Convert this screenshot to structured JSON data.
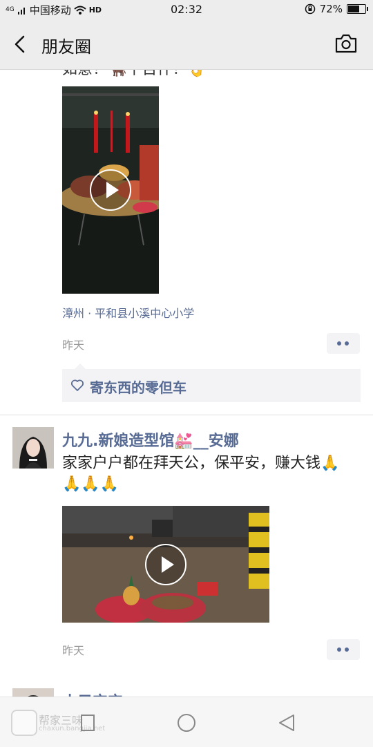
{
  "status_bar": {
    "network": "4G",
    "carrier": "中国移动",
    "hd": "HD",
    "time": "02:32",
    "battery": "72%",
    "battery_level": 0.72
  },
  "header": {
    "title": "朋友圈",
    "back_icon": "back-arrow-icon",
    "camera_icon": "camera-icon"
  },
  "posts": [
    {
      "text_cut": "如意！🐂千百什！👌",
      "location": "漳州 · 平和县小溪中心小学",
      "time": "昨天",
      "likes": "寄东西的零但车"
    },
    {
      "author": "九九.新娘造型馆💒__安娜",
      "text": "家家户户都在拜天公，保平安，赚大钱🙏🙏🙏🙏",
      "time": "昨天"
    },
    {
      "author_cut": "小只宝宝"
    }
  ],
  "watermark": {
    "text": "帮家三味",
    "sub": "chaxun.bangjia.net"
  },
  "colors": {
    "link": "#576b95",
    "bar": "#ededed",
    "bubble": "#f3f3f5"
  }
}
